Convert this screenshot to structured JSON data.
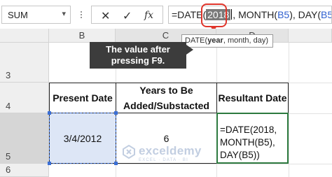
{
  "formula_bar": {
    "name_box": "SUM",
    "name_box_arrow": "▾",
    "cancel_glyph": "✕",
    "enter_glyph": "✓",
    "fx_glyph": "fx",
    "formula_prefix": "=DATE(",
    "formula_highlight": "2018",
    "formula_mid": ", MONTH(",
    "ref1": "B5",
    "formula_mid2": "), DAY(",
    "ref2": "B5",
    "formula_suffix": "))"
  },
  "tooltip": {
    "prefix": "DATE(",
    "bold_arg": "year",
    "rest": ", month, day)"
  },
  "callout": {
    "line1": "The value after",
    "line2": "pressing F9."
  },
  "columns": [
    "B",
    "C",
    "D"
  ],
  "rows": [
    "3",
    "4",
    "5",
    "6"
  ],
  "table": {
    "headers": [
      {
        "line1": "Present Date",
        "line2": ""
      },
      {
        "line1": "Years to Be",
        "line2": "Added/Substacted"
      },
      {
        "line1": "Resultant Date",
        "line2": ""
      }
    ],
    "present_date": "3/4/2012",
    "years": "6",
    "result_lines": [
      "=DATE(2018,",
      "MONTH(B5),",
      "DAY(B5))"
    ]
  },
  "watermark": {
    "name": "exceldemy",
    "tagline": "EXCEL · DATA · BI"
  },
  "colors": {
    "highlight_red": "#e0352b",
    "reference_blue": "#2f5fcf",
    "selection_blue": "#3b6fd6",
    "active_green": "#2d7a3f"
  }
}
